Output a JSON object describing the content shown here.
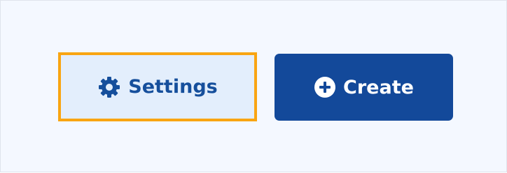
{
  "buttons": {
    "settings": {
      "label": "Settings",
      "icon": "gear-icon",
      "focused": true
    },
    "create": {
      "label": "Create",
      "icon": "plus-circle-icon"
    }
  },
  "colors": {
    "panel_background": "#f4f8ff",
    "panel_border": "#dfe4ec",
    "settings_background": "#e3eefc",
    "settings_text": "#164f9c",
    "focus_outline": "#f9a512",
    "create_background": "#13499a",
    "create_text": "#ffffff"
  }
}
